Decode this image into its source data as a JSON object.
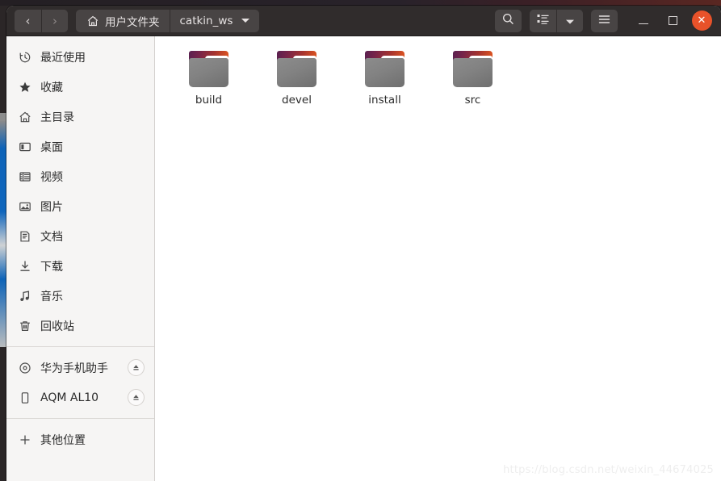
{
  "window": {
    "title": "catkin_ws",
    "accent_close_color": "#e8522a",
    "headerbar_color": "#302c2c",
    "sidebar_color": "#f6f5f4"
  },
  "headerbar": {
    "back_label": "‹",
    "forward_label": "›",
    "breadcrumbs": [
      {
        "label": "用户文件夹",
        "icon": "home-icon",
        "has_caret": false
      },
      {
        "label": "catkin_ws",
        "icon": "",
        "has_caret": true
      }
    ],
    "search_label": "",
    "view_toggle_label": "",
    "view_dropdown_label": "",
    "menu_label": "",
    "minimize_label": "",
    "maximize_label": "",
    "close_label": "✕"
  },
  "sidebar": {
    "groups": [
      {
        "items": [
          {
            "label": "最近使用",
            "icon": "clock-icon",
            "eject": false
          },
          {
            "label": "收藏",
            "icon": "star-icon",
            "eject": false
          },
          {
            "label": "主目录",
            "icon": "home-icon",
            "eject": false
          },
          {
            "label": "桌面",
            "icon": "desktop-icon",
            "eject": false
          },
          {
            "label": "视频",
            "icon": "video-icon",
            "eject": false
          },
          {
            "label": "图片",
            "icon": "image-icon",
            "eject": false
          },
          {
            "label": "文档",
            "icon": "document-icon",
            "eject": false
          },
          {
            "label": "下载",
            "icon": "download-icon",
            "eject": false
          },
          {
            "label": "音乐",
            "icon": "music-icon",
            "eject": false
          },
          {
            "label": "回收站",
            "icon": "trash-icon",
            "eject": false
          }
        ]
      },
      {
        "items": [
          {
            "label": "华为手机助手",
            "icon": "disc-icon",
            "eject": true
          },
          {
            "label": "AQM AL10",
            "icon": "phone-icon",
            "eject": true
          }
        ]
      },
      {
        "items": [
          {
            "label": "其他位置",
            "icon": "plus-icon",
            "eject": false
          }
        ]
      }
    ]
  },
  "content": {
    "files": [
      {
        "name": "build",
        "type": "folder"
      },
      {
        "name": "devel",
        "type": "folder"
      },
      {
        "name": "install",
        "type": "folder"
      },
      {
        "name": "src",
        "type": "folder"
      }
    ]
  },
  "watermark": {
    "text": "https://blog.csdn.net/weixin_44674025"
  }
}
